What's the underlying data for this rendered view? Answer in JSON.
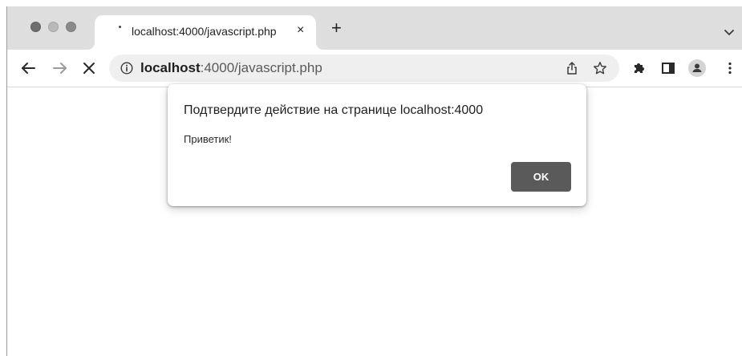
{
  "browser": {
    "tab": {
      "title": "localhost:4000/javascript.php",
      "close_glyph": "×"
    },
    "new_tab_glyph": "+",
    "address_bar": {
      "host": "localhost",
      "path": ":4000/javascript.php"
    },
    "icons": {
      "tab_search": "chevron-down-icon",
      "back": "arrow-left-icon",
      "forward": "arrow-right-icon",
      "stop": "close-icon",
      "site_info": "info-icon",
      "share": "share-icon",
      "bookmark": "star-icon",
      "extensions": "puzzle-icon",
      "side_panel": "side-panel-icon",
      "profile": "profile-icon",
      "menu": "kebab-menu-icon"
    }
  },
  "dialog": {
    "title": "Подтвердите действие на странице localhost:4000",
    "message": "Приветик!",
    "ok_label": "OK"
  },
  "colors": {
    "tabstrip_bg": "#dedede",
    "omnibox_bg": "#efefef",
    "ok_button_bg": "#5a5a5a"
  }
}
